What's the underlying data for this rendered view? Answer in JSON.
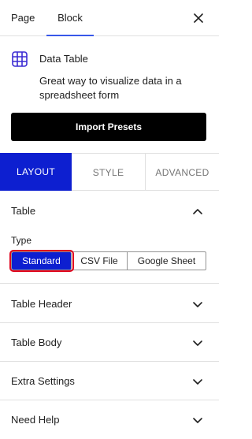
{
  "top_tabs": {
    "page_label": "Page",
    "block_label": "Block"
  },
  "block": {
    "icon": "table-grid-icon",
    "name": "Data Table",
    "description": "Great way to visualize data in a spreadsheet form",
    "import_label": "Import Presets"
  },
  "settings_tabs": {
    "layout": "LAYOUT",
    "style": "STYLE",
    "advanced": "ADVANCED",
    "active": "LAYOUT"
  },
  "table_panel": {
    "title": "Table",
    "expanded": true,
    "type_label": "Type",
    "type_options": [
      "Standard",
      "CSV File",
      "Google Sheet"
    ],
    "selected": "Standard"
  },
  "panels": [
    "Table Header",
    "Table Body",
    "Extra Settings",
    "Need Help"
  ],
  "colors": {
    "accent": "#0d1fd0",
    "highlight": "#e0001b",
    "tab_underline": "#3858e9"
  }
}
